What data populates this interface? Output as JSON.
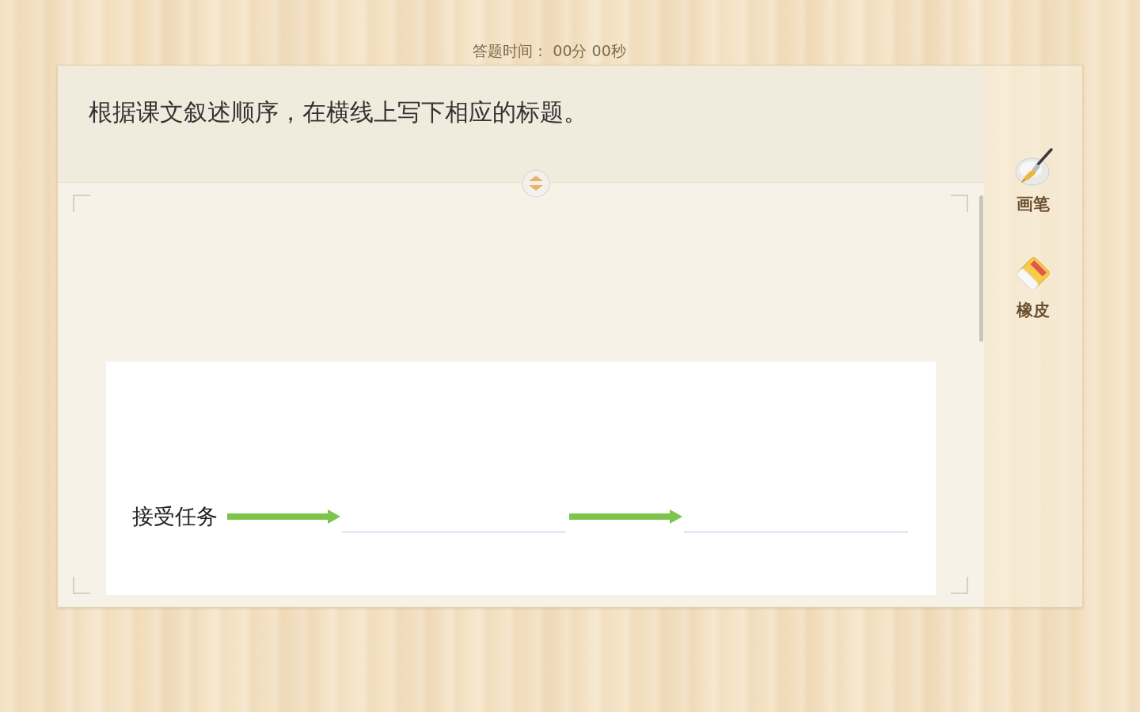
{
  "timer": {
    "text": "答题时间： 00分 00秒"
  },
  "question": {
    "prompt": "根据课文叙述顺序，在横线上写下相应的标题。",
    "figure": {
      "items": [
        {
          "kind": "text",
          "text": "接受任务"
        },
        {
          "kind": "arrow"
        },
        {
          "kind": "blank"
        },
        {
          "kind": "arrow"
        },
        {
          "kind": "blank"
        }
      ]
    }
  },
  "tools": [
    {
      "kind": "brush",
      "label": "画笔"
    },
    {
      "kind": "eraser",
      "label": "橡皮"
    }
  ]
}
